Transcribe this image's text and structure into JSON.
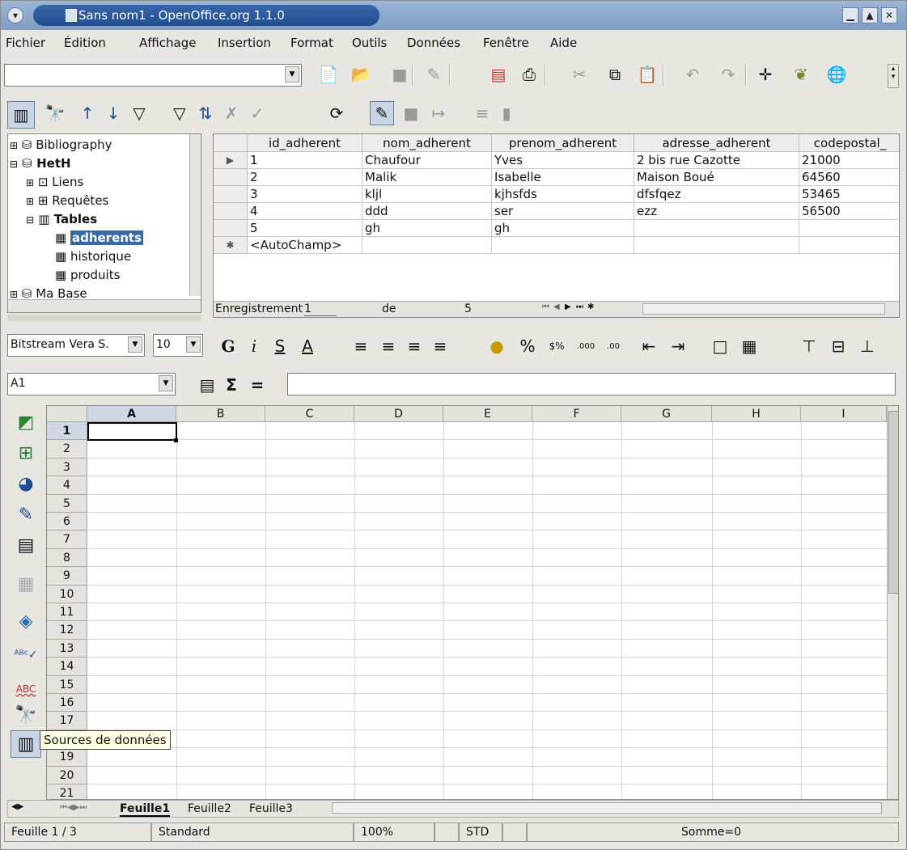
{
  "window": {
    "title": "Sans nom1 - OpenOffice.org 1.1.0"
  },
  "menu": [
    "Fichier",
    "Édition",
    "Affichage",
    "Insertion",
    "Format",
    "Outils",
    "Données",
    "Fenêtre",
    "Aide"
  ],
  "tree": {
    "items": [
      {
        "label": "Bibliography",
        "level": 0,
        "expander": "⊞",
        "bold": false
      },
      {
        "label": "HetH",
        "level": 0,
        "expander": "⊟",
        "bold": true
      },
      {
        "label": "Liens",
        "level": 1,
        "expander": "⊞",
        "bold": false
      },
      {
        "label": "Requêtes",
        "level": 1,
        "expander": "⊞",
        "bold": false
      },
      {
        "label": "Tables",
        "level": 1,
        "expander": "⊟",
        "bold": true
      },
      {
        "label": "adherents",
        "level": 2,
        "expander": "",
        "bold": true,
        "selected": true
      },
      {
        "label": "historique",
        "level": 2,
        "expander": "",
        "bold": false
      },
      {
        "label": "produits",
        "level": 2,
        "expander": "",
        "bold": false
      },
      {
        "label": "Ma Base",
        "level": 0,
        "expander": "⊞",
        "bold": false
      }
    ]
  },
  "dbgrid": {
    "columns": [
      "id_adherent",
      "nom_adherent",
      "prenom_adherent",
      "adresse_adherent",
      "codepostal_"
    ],
    "rows": [
      [
        "1",
        "Chaufour",
        "Yves",
        "2 bis rue Cazotte",
        "21000"
      ],
      [
        "2",
        "Malik",
        "Isabelle",
        "Maison Boué",
        "64560"
      ],
      [
        "3",
        "kljl",
        "kjhsfds",
        "dfsfqez",
        "53465"
      ],
      [
        "4",
        "ddd",
        "ser",
        "ezz",
        "56500"
      ],
      [
        "5",
        "gh",
        "gh",
        "",
        ""
      ]
    ],
    "new_row": "<AutoChamp>",
    "nav_label": "Enregistrement",
    "nav_current": "1",
    "nav_of": "de",
    "nav_total": "5"
  },
  "format": {
    "font": "Bitstream Vera S.",
    "size": "10"
  },
  "formula": {
    "cell_ref": "A1",
    "content": ""
  },
  "sheet": {
    "columns": [
      "A",
      "B",
      "C",
      "D",
      "E",
      "F",
      "G",
      "H",
      "I"
    ],
    "rows": [
      "1",
      "2",
      "3",
      "4",
      "5",
      "6",
      "7",
      "8",
      "9",
      "10",
      "11",
      "12",
      "13",
      "14",
      "15",
      "16",
      "17",
      "18",
      "19",
      "20",
      "21"
    ],
    "tabs": [
      "Feuille1",
      "Feuille2",
      "Feuille3"
    ],
    "active_tab": "Feuille1"
  },
  "tooltip": "Sources de données",
  "status": {
    "sheet": "Feuille 1 / 3",
    "style": "Standard",
    "zoom": "100%",
    "mode": "STD",
    "sum": "Somme=0"
  }
}
